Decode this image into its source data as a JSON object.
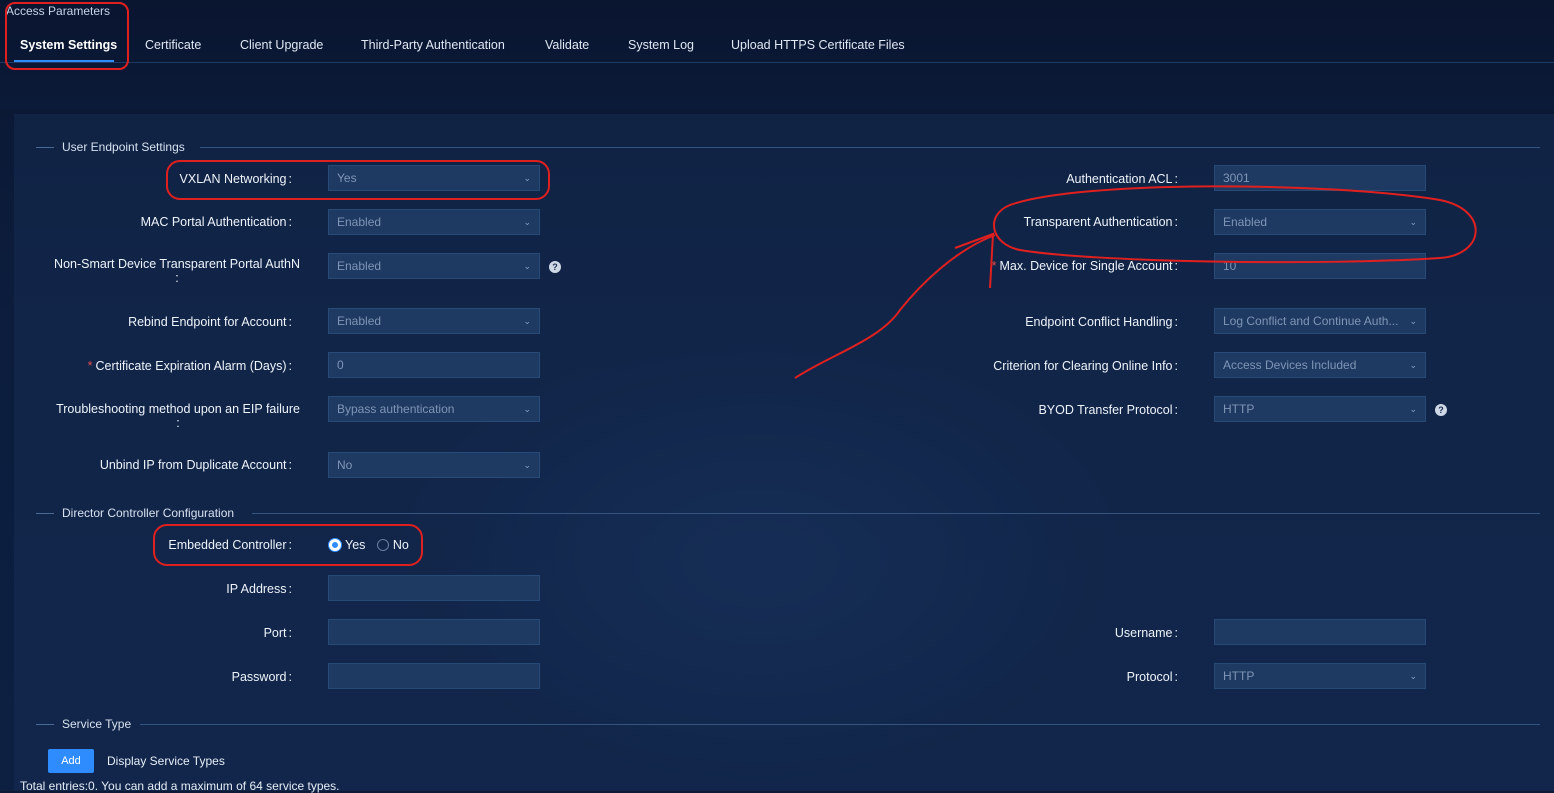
{
  "breadcrumb": "Access Parameters",
  "tabs": [
    "System Settings",
    "Certificate",
    "Client Upgrade",
    "Third-Party Authentication",
    "Validate",
    "System Log",
    "Upload HTTPS Certificate Files"
  ],
  "sections": {
    "user_endpoint": "User Endpoint Settings",
    "director": "Director Controller Configuration",
    "service_type": "Service Type"
  },
  "left_fields": {
    "vxlan": {
      "label": "VXLAN Networking",
      "value": "Yes"
    },
    "mac_portal": {
      "label": "MAC Portal Authentication",
      "value": "Enabled"
    },
    "non_smart": {
      "label_line1": "Non-Smart Device Transparent Portal AuthN",
      "value": "Enabled"
    },
    "rebind": {
      "label": "Rebind Endpoint for Account",
      "value": "Enabled"
    },
    "cert_alarm": {
      "label": "Certificate Expiration Alarm (Days)",
      "value": "0"
    },
    "troubleshoot": {
      "label_line1": "Troubleshooting method upon an EIP failure",
      "value": "Bypass authentication"
    },
    "unbind_ip": {
      "label": "Unbind IP from Duplicate Account",
      "value": "No"
    }
  },
  "right_fields": {
    "auth_acl": {
      "label": "Authentication ACL",
      "value": "3001"
    },
    "transparent_auth": {
      "label": "Transparent Authentication",
      "value": "Enabled"
    },
    "max_device": {
      "label": "Max. Device for Single Account",
      "value": "10"
    },
    "conflict": {
      "label": "Endpoint Conflict Handling",
      "value": "Log Conflict and Continue Auth..."
    },
    "clearing": {
      "label": "Criterion for Clearing Online Info",
      "value": "Access Devices Included"
    },
    "byod": {
      "label": "BYOD Transfer Protocol",
      "value": "HTTP"
    }
  },
  "colon": ":",
  "required_mark": "*",
  "help_mark": "?",
  "chevron": "⌄",
  "director": {
    "embedded_label": "Embedded Controller",
    "option_yes": "Yes",
    "option_no": "No",
    "selected": "Yes",
    "ip_label": "IP Address",
    "port_label": "Port",
    "password_label": "Password",
    "username_label": "Username",
    "protocol_label": "Protocol",
    "protocol_value": "HTTP"
  },
  "service": {
    "add_label": "Add",
    "display_label": "Display Service Types",
    "total_text": "Total entries:0. You can add a maximum of 64 service types."
  },
  "colors": {
    "accent": "#2f8cff",
    "annotation_red": "#e0201f",
    "field_bg": "#1e3a62"
  }
}
